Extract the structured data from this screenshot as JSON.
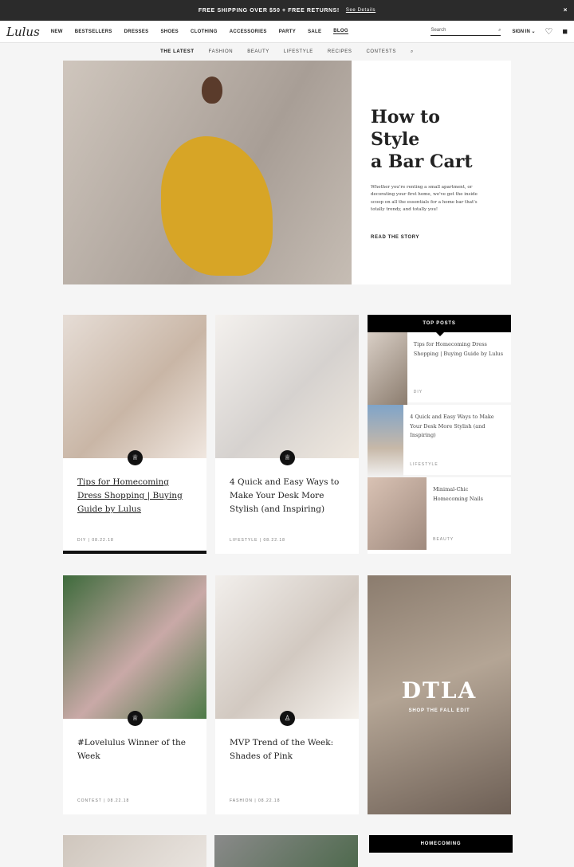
{
  "promo": {
    "text": "FREE SHIPPING OVER $50 + FREE RETURNS!",
    "link": "See Details",
    "close": "×"
  },
  "nav": {
    "logo": "Lulus",
    "items": [
      "NEW",
      "BESTSELLERS",
      "DRESSES",
      "SHOES",
      "CLOTHING",
      "ACCESSORIES",
      "PARTY",
      "SALE",
      "BLOG"
    ],
    "search_placeholder": "Search",
    "signin": "SIGN IN ⌄"
  },
  "subnav": [
    "THE LATEST",
    "FASHION",
    "BEAUTY",
    "LIFESTYLE",
    "RECIPES",
    "CONTESTS"
  ],
  "hero": {
    "title_line1": "How to Style",
    "title_line2": "a Bar Cart",
    "body": "Whether you're renting a small apartment, or decorating your first home, we've got the inside scoop on all the essentials for a home bar that's totally trendy, and totally you!",
    "cta": "READ THE STORY"
  },
  "cards": [
    {
      "title": "Tips for Homecoming Dress Shopping | Buying Guide by Lulus",
      "meta": "DIY  |  08.22.18"
    },
    {
      "title": "4 Quick and Easy Ways to Make Your Desk More Stylish (and Inspiring)",
      "meta": "LIFESTYLE  |  08.22.18"
    },
    {
      "title": "#Lovelulus Winner of the Week",
      "meta": "CONTEST  |  08.22.18"
    },
    {
      "title": "MVP Trend of the Week: Shades of Pink",
      "meta": "FASHION  |  08.22.18"
    }
  ],
  "top_posts": {
    "heading": "TOP POSTS",
    "items": [
      {
        "title": "Tips for Homecoming Dress Shopping | Buying Guide by Lulus",
        "category": "DIY"
      },
      {
        "title": "4 Quick and Easy Ways to Make Your Desk More Stylish (and Inspiring)",
        "category": "LIFESTYLE"
      },
      {
        "title": "Minimal-Chic Homecoming Nails",
        "category": "BEAUTY"
      }
    ]
  },
  "promo_tile": {
    "title": "DTLA",
    "subtitle": "SHOP THE FALL EDIT"
  },
  "homecoming": "HOMECOMING"
}
